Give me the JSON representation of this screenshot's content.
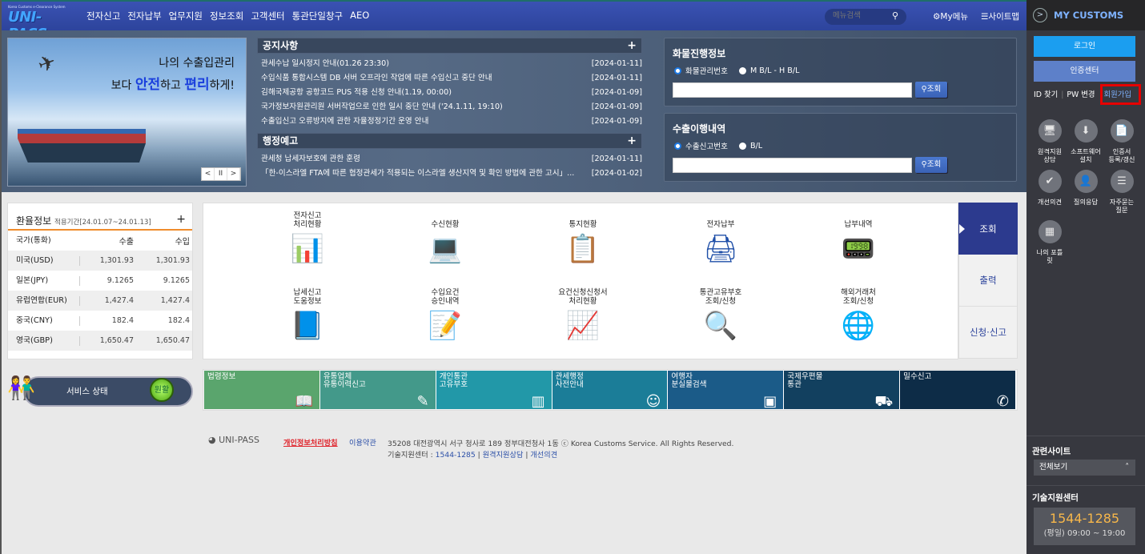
{
  "header": {
    "logo_small": "Korea Customs e-Clearance System",
    "logo": "UNI-PASS",
    "menu": [
      "전자신고",
      "전자납부",
      "업무지원",
      "정보조회",
      "고객센터",
      "통관단일창구",
      "AEO"
    ],
    "search_placeholder": "메뉴검색",
    "mymenu": "My메뉴",
    "sitemap": "사이트맵"
  },
  "banner": {
    "line1": "나의 수출입관리",
    "line2_pre": "보다 ",
    "line2_b1": "안전",
    "line2_mid": "하고 ",
    "line2_b2": "편리",
    "line2_post": "하게!",
    "controls": [
      "<",
      "II",
      ">"
    ]
  },
  "notices": {
    "title": "공지사항",
    "items": [
      {
        "text": "관세수납 일시정지 안내(01.26 23:30)",
        "date": "[2024-01-11]"
      },
      {
        "text": "수입식품 통합시스템 DB 서버 오프라인 작업에 따른 수입신고 중단 안내",
        "date": "[2024-01-11]"
      },
      {
        "text": "김해국제공항 공항코드 PUS 적용 신청 안내(1.19, 00:00)",
        "date": "[2024-01-09]"
      },
      {
        "text": "국가정보자원관리원 서버작업으로 인한 일시 중단 안내 ('24.1.11, 19:10)",
        "date": "[2024-01-09]"
      },
      {
        "text": "수출입신고 오류방지에 관한 자율정정기간 운영 안내",
        "date": "[2024-01-09]"
      }
    ]
  },
  "admin_notice": {
    "title": "행정예고",
    "items": [
      {
        "text": "관세청 납세자보호에 관한 훈령",
        "date": "[2024-01-11]"
      },
      {
        "text": "「한-이스라엘 FTA에 따른 협정관세가 적용되는 이스라엘 생산지역 및 확인 방법에 관한 고시」...",
        "date": "[2024-01-02]"
      }
    ]
  },
  "cargo": {
    "title": "화물진행정보",
    "options": [
      "화물관리번호",
      "M B/L - H B/L"
    ],
    "selected": 0,
    "value": "",
    "button": "조회"
  },
  "export": {
    "title": "수출이행내역",
    "options": [
      "수출신고번호",
      "B/L"
    ],
    "selected": 0,
    "value": "",
    "button": "조회"
  },
  "exchange": {
    "title": "환율정보",
    "period": "적용기간[24.01.07~24.01.13]",
    "headers": [
      "국가(통화)",
      "수출",
      "수입"
    ],
    "rows": [
      [
        "미국(USD)",
        "1,301.93",
        "1,301.93"
      ],
      [
        "일본(JPY)",
        "9.1265",
        "9.1265"
      ],
      [
        "유럽연합(EUR)",
        "1,427.4",
        "1,427.4"
      ],
      [
        "중국(CNY)",
        "182.4",
        "182.4"
      ],
      [
        "영국(GBP)",
        "1,650.47",
        "1,650.47"
      ]
    ]
  },
  "services": [
    {
      "label": "전자신고\n처리현황",
      "icon": "bar-chart-icon"
    },
    {
      "label": "수신현황",
      "icon": "laptop-mail-icon"
    },
    {
      "label": "통지현황",
      "icon": "clipboard-chart-icon"
    },
    {
      "label": "전자납부",
      "icon": "payment-terminal-icon"
    },
    {
      "label": "납부내역",
      "icon": "card-reader-icon"
    },
    {
      "label": "납세신고\n도움정보",
      "icon": "help-book-icon"
    },
    {
      "label": "수입요건\n승인내역",
      "icon": "import-document-icon"
    },
    {
      "label": "요건신청신청서\n처리현황",
      "icon": "pie-document-icon"
    },
    {
      "label": "통관고유부호\n조회/신청",
      "icon": "barcode-search-icon"
    },
    {
      "label": "해외거래처\n조회/신청",
      "icon": "globe-search-icon"
    }
  ],
  "tabs": [
    {
      "label": "조회",
      "active": true
    },
    {
      "label": "출력",
      "active": false
    },
    {
      "label": "신청·신고",
      "active": false
    }
  ],
  "service_status": {
    "label": "서비스 상태",
    "state": "원활"
  },
  "quick_links": [
    {
      "label": "법령정보",
      "color": "#5aa56d",
      "icon": "book-icon"
    },
    {
      "label": "유통업체\n유통이력신고",
      "color": "#43998a",
      "icon": "stamp-icon"
    },
    {
      "label": "개인통관\n고유부호",
      "color": "#2298a8",
      "icon": "barcode-icon"
    },
    {
      "label": "관세행정\n사전안내",
      "color": "#1b7d98",
      "icon": "headset-icon"
    },
    {
      "label": "여행자\n분실물검색",
      "color": "#1b5b88",
      "icon": "box-icon"
    },
    {
      "label": "국제우편물\n통관",
      "color": "#12405f",
      "icon": "hand-truck-icon"
    },
    {
      "label": "밀수신고",
      "color": "#0d2c47",
      "icon": "phone-24h-icon"
    }
  ],
  "footer": {
    "logo": "UNI-PASS",
    "privacy": "개인정보처리방침",
    "terms": "이용약관",
    "address": "35208 대전광역시 서구 청사로 189 정부대전청사 1동 ⓒ Korea Customs Service. All Rights Reserved.",
    "tech_label": "기술지원센터 : ",
    "tech_phone": "1544-1285",
    "remote": "원격지원상담",
    "feedback": "개선의견"
  },
  "sidebar": {
    "title": "MY CUSTOMS",
    "login": "로그인",
    "cert": "인증센터",
    "find_id": "ID 찾기",
    "pw_change": "PW 변경",
    "join": "회원가입",
    "shortcuts": [
      {
        "label": "원격지원\n상담",
        "icon": "remote-support-icon"
      },
      {
        "label": "소프트웨어\n설치",
        "icon": "software-install-icon"
      },
      {
        "label": "인증서\n등록/갱신",
        "icon": "certificate-icon"
      },
      {
        "label": "개선의견",
        "icon": "feedback-icon"
      },
      {
        "label": "질의응답",
        "icon": "qna-icon"
      },
      {
        "label": "자주묻는\n질문",
        "icon": "faq-icon"
      },
      {
        "label": "나의 포틀\n릿",
        "icon": "portlet-icon"
      }
    ],
    "related_title": "관련사이트",
    "related_select": "전체보기",
    "tech_title": "기술지원센터",
    "tech_phone": "1544-1285",
    "tech_hours": "(평일) 09:00 ~ 19:00"
  },
  "colors": {
    "accent": "#2d449c",
    "highlight": "#e60000",
    "sidebar_bg": "#37383f",
    "login": "#1b9ef0"
  }
}
